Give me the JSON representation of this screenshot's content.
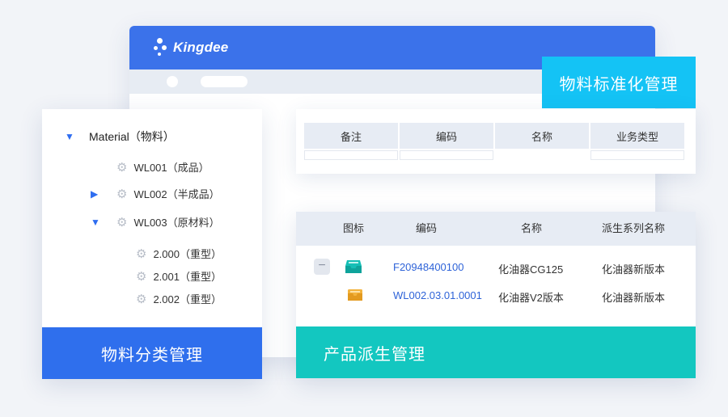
{
  "app": {
    "logo_text": "Kingdee"
  },
  "badges": {
    "material_standard": "物料标准化管理",
    "material_category": "物料分类管理",
    "product_derivation": "产品派生管理"
  },
  "tree": {
    "root": "Material（物料）",
    "items": [
      {
        "label": "WL001（成品）"
      },
      {
        "label": "WL002（半成品）"
      },
      {
        "label": "WL003（原材料）"
      },
      {
        "label": "2.000（重型）"
      },
      {
        "label": "2.001（重型）"
      },
      {
        "label": "2.002（重型）"
      }
    ]
  },
  "material_table": {
    "columns": [
      "备注",
      "编码",
      "名称",
      "业务类型"
    ]
  },
  "product_table": {
    "columns": [
      "图标",
      "编码",
      "名称",
      "派生系列名称"
    ],
    "rows": [
      {
        "code": "F20948400100",
        "name": "化油器CG125",
        "series": "化油器新版本"
      },
      {
        "code": "WL002.03.01.0001",
        "name": "化油器V2版本",
        "series": "化油器新版本"
      }
    ]
  },
  "colors": {
    "brand_blue": "#3b72ea",
    "category_banner": "#2f6fed",
    "standard_badge": "#14c3f5",
    "product_banner": "#13c7c0",
    "link": "#2e63d8"
  },
  "icons": {
    "tree_expanded": "triangle-down-icon",
    "tree_collapsed": "triangle-right-icon",
    "node": "gear-icon",
    "collapse": "minus-icon",
    "row_icon_1": "inbox-teal-icon",
    "row_icon_2": "envelope-orange-icon"
  }
}
